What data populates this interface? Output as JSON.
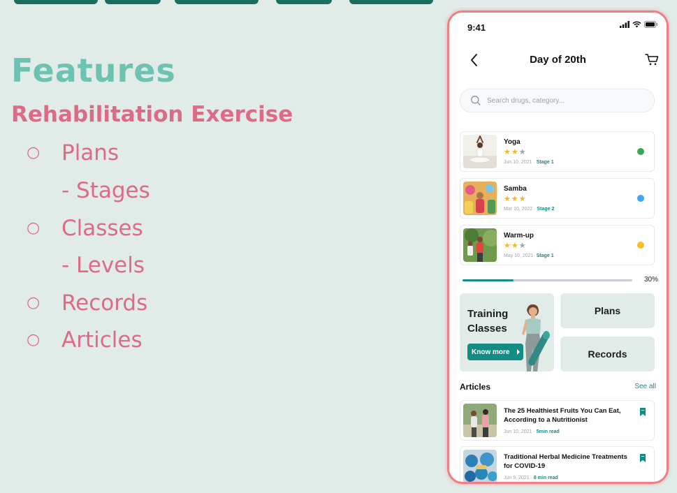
{
  "colors": {
    "background": "#e1ece8",
    "heading": "#6dc2b2",
    "accent_pink": "#dd6b86",
    "primary": "#138d84",
    "phone_border": "#f07e82"
  },
  "slide": {
    "title": "Features",
    "subtitle": "Rehabilitation Exercise",
    "bullet_symbol": "○",
    "bullets": [
      {
        "text": "Plans",
        "level": 1
      },
      {
        "text": "- Stages",
        "level": 2
      },
      {
        "text": "Classes",
        "level": 1
      },
      {
        "text": "- Levels",
        "level": 2
      },
      {
        "text": "Records",
        "level": 1
      },
      {
        "text": "Articles",
        "level": 1
      }
    ]
  },
  "phone": {
    "status_time": "9:41",
    "status_icons": [
      "signal-icon",
      "wifi-icon",
      "battery-icon"
    ],
    "header": {
      "title": "Day of 20th",
      "back_icon": "chevron-left-icon",
      "cart_icon": "cart-icon"
    },
    "search": {
      "placeholder": "Search drugs, category...",
      "value": ""
    },
    "sessions": [
      {
        "title": "Yoga",
        "rating": 2,
        "max_rating": 3,
        "date": "Jun 10, 2021 · ",
        "stage": "Stage 1",
        "status_color": "#36a853"
      },
      {
        "title": "Samba",
        "rating": 3,
        "max_rating": 3,
        "date": "Mar 10, 2022 · ",
        "stage": "Stage 2",
        "status_color": "#3ea6f4"
      },
      {
        "title": "Warm-up",
        "rating": 2,
        "max_rating": 3,
        "date": "May 10, 2021· ",
        "stage": "Stage 1",
        "status_color": "#fbbc2b"
      }
    ],
    "progress": {
      "value": 0.3,
      "label": "30%"
    },
    "tiles": {
      "training_line1": "Training",
      "training_line2": "Classes",
      "know_more": "Know more",
      "plans": "Plans",
      "records": "Records"
    },
    "articles": {
      "heading": "Articles",
      "see_all": "See all",
      "items": [
        {
          "title": "The 25 Healthiest Fruits You Can Eat, According to a Nutritionist",
          "date": "Jun 10, 2021 · ",
          "read": "5min read"
        },
        {
          "title": "Traditional Herbal Medicine Treatments for COVID-19",
          "date": "Jun 9, 2021 · ",
          "read": "8 min read"
        }
      ]
    }
  }
}
